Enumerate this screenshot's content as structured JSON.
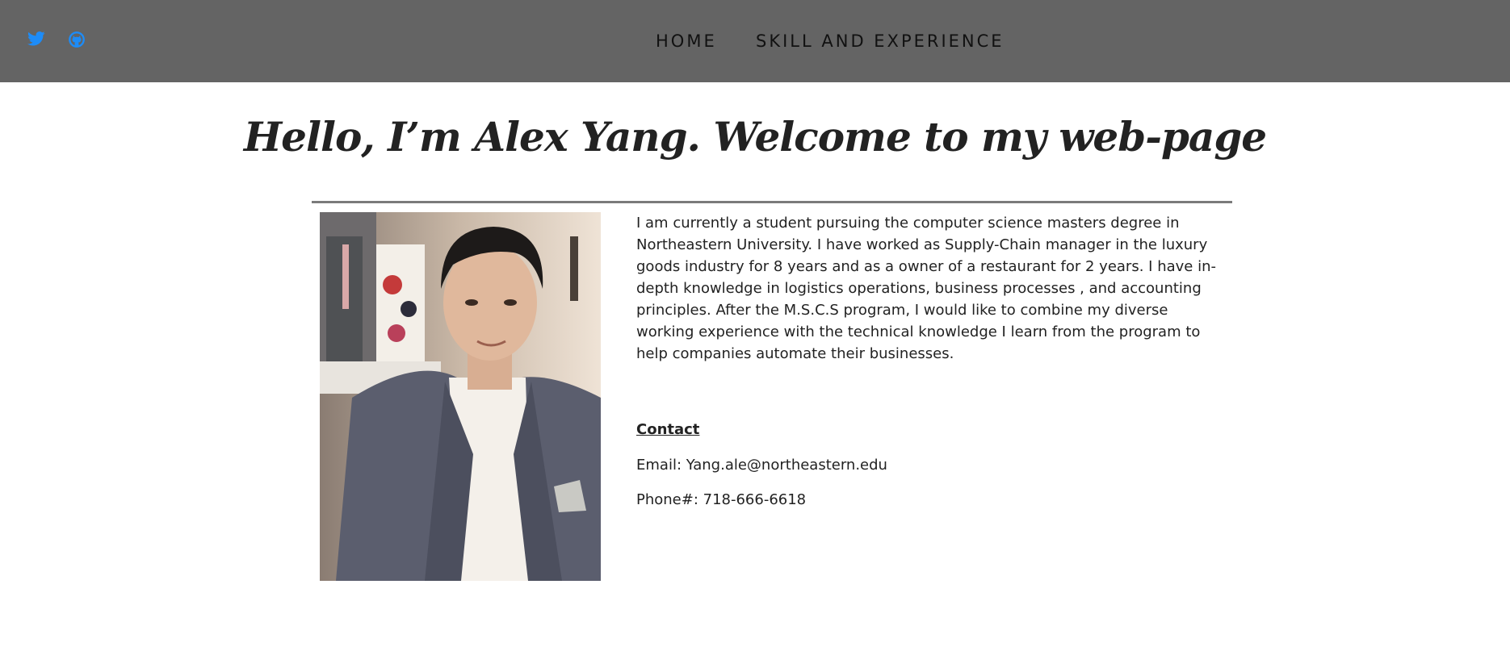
{
  "header": {
    "social": [
      {
        "icon": "twitter-icon",
        "color": "#1d8cf8"
      },
      {
        "icon": "github-icon",
        "color": "#1d8cf8"
      }
    ],
    "nav": {
      "home_label": "HOME",
      "skill_label": "SKILL AND EXPERIENCE"
    },
    "background": "#646464"
  },
  "main": {
    "headline": "Hello, I’m Alex Yang. Welcome to my web-page",
    "bio": "I am currently a student pursuing the computer science masters degree in Northeastern University. I have worked as Supply-Chain manager in the luxury goods industry for 8 years and as a owner of a restaurant for 2 years. I have in-depth knowledge in logistics operations, business processes , and accounting principles. After the M.S.C.S program, I would like to combine my diverse working experience with the technical knowledge I learn from the program to help companies automate their businesses.",
    "contact": {
      "heading": "Contact",
      "email_line": "Email: Yang.ale@northeastern.edu",
      "phone_line": "Phone#: 718-666-6618"
    }
  }
}
